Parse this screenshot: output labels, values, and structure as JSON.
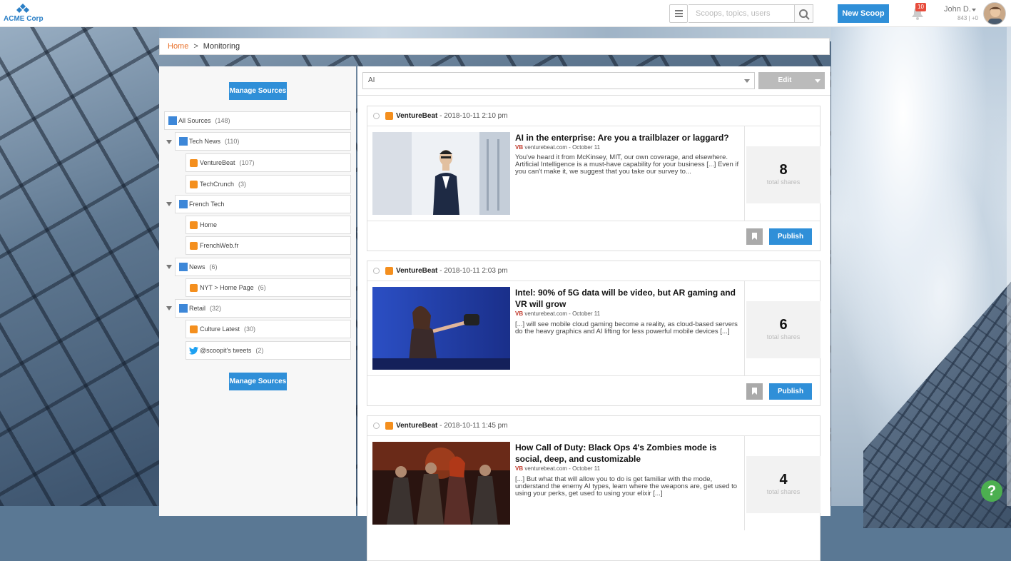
{
  "header": {
    "logo_text": "ACME Corp",
    "search_placeholder": "Scoops, topics, users",
    "new_scoop_label": "New Scoop",
    "notification_count": "10",
    "user_name": "John D.",
    "user_stats": "843 | +0"
  },
  "breadcrumb": {
    "home": "Home",
    "separator": ">",
    "current": "Monitoring"
  },
  "sidebar": {
    "manage_label": "Manage Sources",
    "tree": [
      {
        "label": "All Sources",
        "count": "(148)"
      },
      {
        "label": "Tech News",
        "count": "(110)"
      },
      {
        "label": "VentureBeat",
        "count": "(107)"
      },
      {
        "label": "TechCrunch",
        "count": "(3)"
      },
      {
        "label": "French Tech",
        "count": ""
      },
      {
        "label": "Home",
        "count": ""
      },
      {
        "label": "FrenchWeb.fr",
        "count": ""
      },
      {
        "label": "News",
        "count": "(6)"
      },
      {
        "label": "NYT > Home Page",
        "count": "(6)"
      },
      {
        "label": "Retail",
        "count": "(32)"
      },
      {
        "label": "Culture Latest",
        "count": "(30)"
      },
      {
        "label": "@scoopit's tweets",
        "count": "(2)"
      }
    ]
  },
  "feed": {
    "filter_value": "AI",
    "edit_label": "Edit",
    "shares_label": "total shares",
    "publish_label": "Publish",
    "cards": [
      {
        "source": "VentureBeat",
        "date": " - 2018-10-11 2:10 pm",
        "title": "AI in the enterprise: Are you a trailblazer or laggard?",
        "site": "venturebeat.com",
        "site_date": " - October 11",
        "excerpt": "You've heard it from McKinsey, MIT, our own coverage, and elsewhere. Artificial Intelligence is a must-have capability for your business [...] Even if you can't make it, we suggest that you take our survey to...",
        "shares": "8"
      },
      {
        "source": "VentureBeat",
        "date": " - 2018-10-11 2:03 pm",
        "title": "Intel: 90% of 5G data will be video, but AR gaming and VR will grow",
        "site": "venturebeat.com",
        "site_date": " - October 11",
        "excerpt": "[...] will see mobile cloud gaming become a reality, as cloud-based servers do the heavy graphics and AI lifting for less powerful mobile devices [...]",
        "shares": "6"
      },
      {
        "source": "VentureBeat",
        "date": " - 2018-10-11 1:45 pm",
        "title": "How Call of Duty: Black Ops 4's Zombies mode is social, deep, and customizable",
        "site": "venturebeat.com",
        "site_date": " - October 11",
        "excerpt": "[...] But what that will allow you to do is get familiar with the mode, understand the enemy AI types, learn where the weapons are, get used to using your perks, get used to using your elixir [...]",
        "shares": "4"
      }
    ]
  },
  "help_label": "?",
  "colors": {
    "accent": "#2f8fd8",
    "folder": "#3d87d8",
    "rss": "#f48f1e",
    "breadcrumb_home": "#e8702a"
  }
}
